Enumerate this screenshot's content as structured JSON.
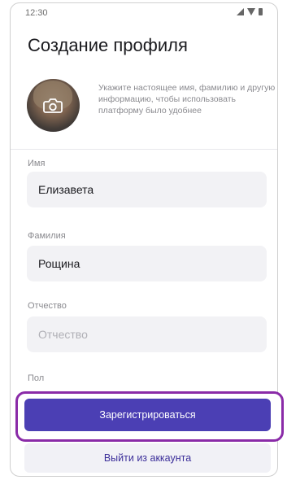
{
  "status_bar": {
    "time": "12:30"
  },
  "page": {
    "title": "Создание профиля"
  },
  "profile": {
    "info": "Укажите настоящее имя, фамилию и другую информацию, чтобы использовать платформу было удобнее"
  },
  "fields": {
    "first_name": {
      "label": "Имя",
      "value": "Елизавета"
    },
    "last_name": {
      "label": "Фамилия",
      "value": "Рощина"
    },
    "patronymic": {
      "label": "Отчество",
      "placeholder": "Отчество"
    },
    "gender": {
      "label": "Пол"
    }
  },
  "actions": {
    "register_label": "Зарегистрироваться",
    "logout_label": "Выйти из аккаунта"
  },
  "colors": {
    "primary": "#4b3fb4",
    "highlight": "#8a2ba8",
    "secondary_bg": "#f1f1f6"
  },
  "icons": [
    "signal-icon",
    "wifi-icon",
    "battery-icon",
    "camera-icon"
  ]
}
